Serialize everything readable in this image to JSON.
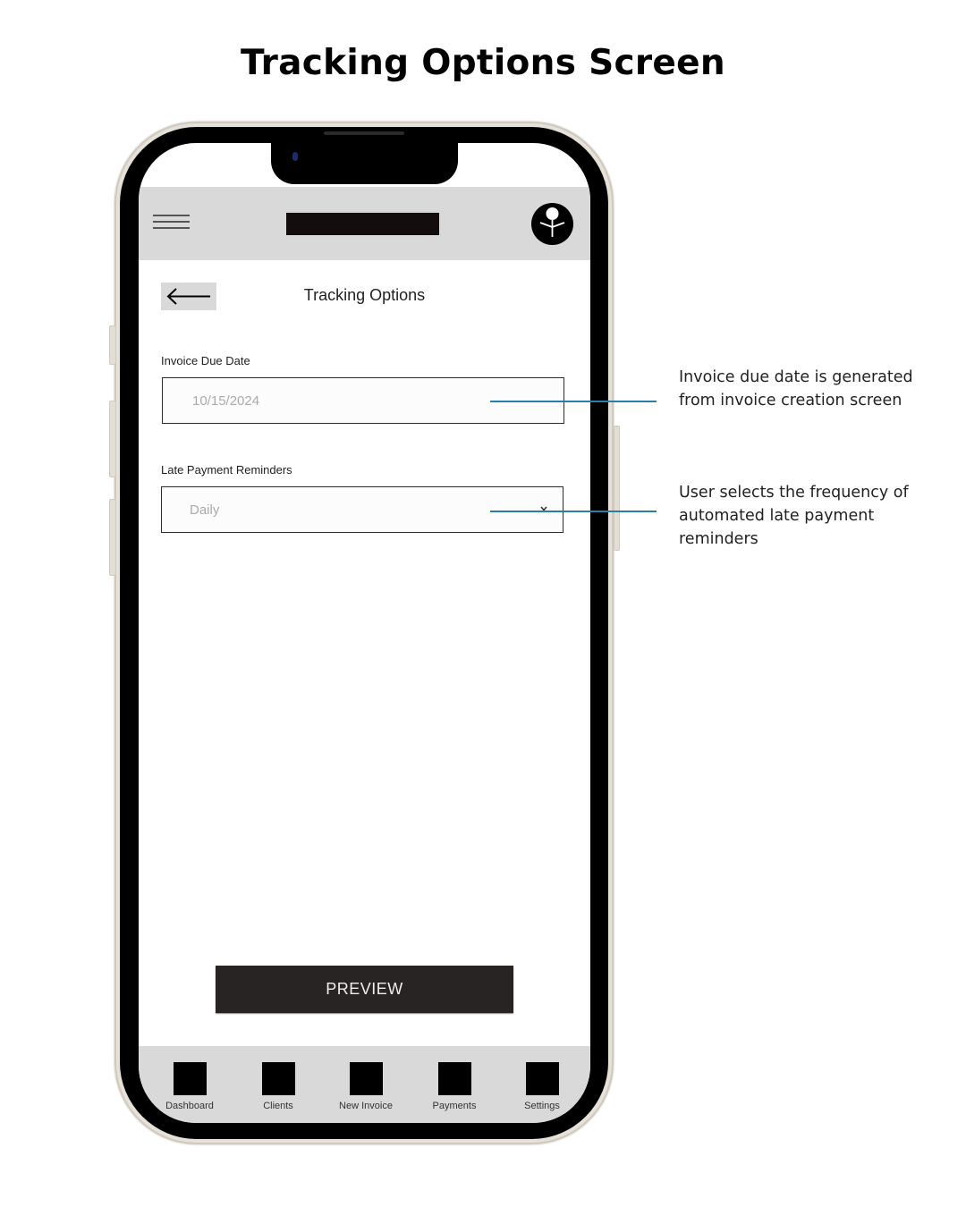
{
  "page": {
    "title": "Tracking Options Screen"
  },
  "app": {
    "header": {
      "menu_icon": "hamburger-menu-icon",
      "logo_placeholder": "logo-bar",
      "avatar_icon": "user-avatar-icon"
    },
    "screen_title": "Tracking Options",
    "back_icon": "arrow-left-icon",
    "fields": [
      {
        "label": "Invoice Due Date",
        "value": "10/15/2024",
        "type": "date"
      },
      {
        "label": "Late Payment Reminders",
        "value": "Daily",
        "type": "dropdown",
        "icon": "chevron-down-icon"
      }
    ],
    "preview_button": "PREVIEW",
    "bottom_nav": [
      {
        "label": "Dashboard"
      },
      {
        "label": "Clients"
      },
      {
        "label": "New Invoice"
      },
      {
        "label": "Payments"
      },
      {
        "label": "Settings"
      }
    ]
  },
  "annotations": [
    {
      "text": "Invoice due date is generated from invoice creation screen"
    },
    {
      "text": "User selects the frequency of automated late payment reminders"
    }
  ],
  "colors": {
    "callout_line": "#2a7fa8",
    "header_bg": "#d9d9d9",
    "button_bg": "#282424"
  }
}
